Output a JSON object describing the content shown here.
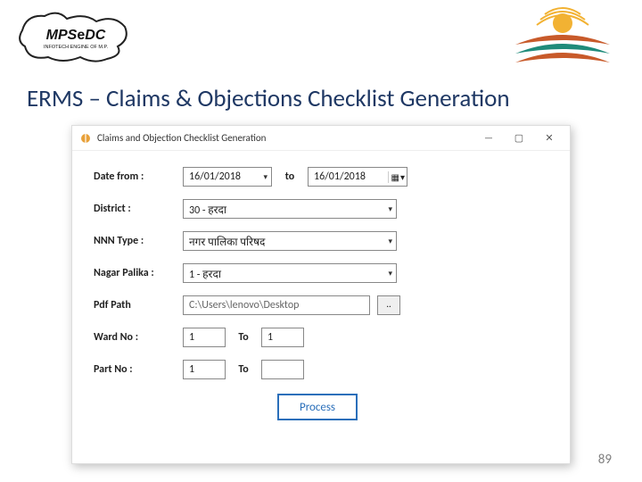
{
  "logos": {
    "left_line1": "MPS@DC",
    "left_line2": "INFOTECH ENGINE OF M.P."
  },
  "page_title": "ERMS – Claims & Objections Checklist Generation",
  "titlebar": {
    "title": "Claims and Objection Checklist Generation",
    "minimize": "—",
    "maximize": "▢",
    "close": "✕"
  },
  "form": {
    "date_from_label": "Date from :",
    "date_from_value": "16/01/2018",
    "date_to_label": "to",
    "date_to_value": "16/01/2018",
    "district_label": "District :",
    "district_value": "30 - हरदा",
    "nnn_type_label": "NNN Type :",
    "nnn_type_value": "नगर पालिका परिषद",
    "nagar_palika_label": "Nagar Palika :",
    "nagar_palika_value": "1 - हरदा",
    "pdf_path_label": "Pdf Path ",
    "pdf_path_value": "C:\\Users\\lenovo\\Desktop",
    "browse_label": "..",
    "ward_no_label": "Ward No :",
    "ward_no_from": "1",
    "ward_no_to_label": "To",
    "ward_no_to": "1",
    "part_no_label": "Part No :",
    "part_no_from": "1",
    "part_no_to_label": "To",
    "part_no_to": "",
    "process_label": "Process"
  },
  "page_number": "89"
}
